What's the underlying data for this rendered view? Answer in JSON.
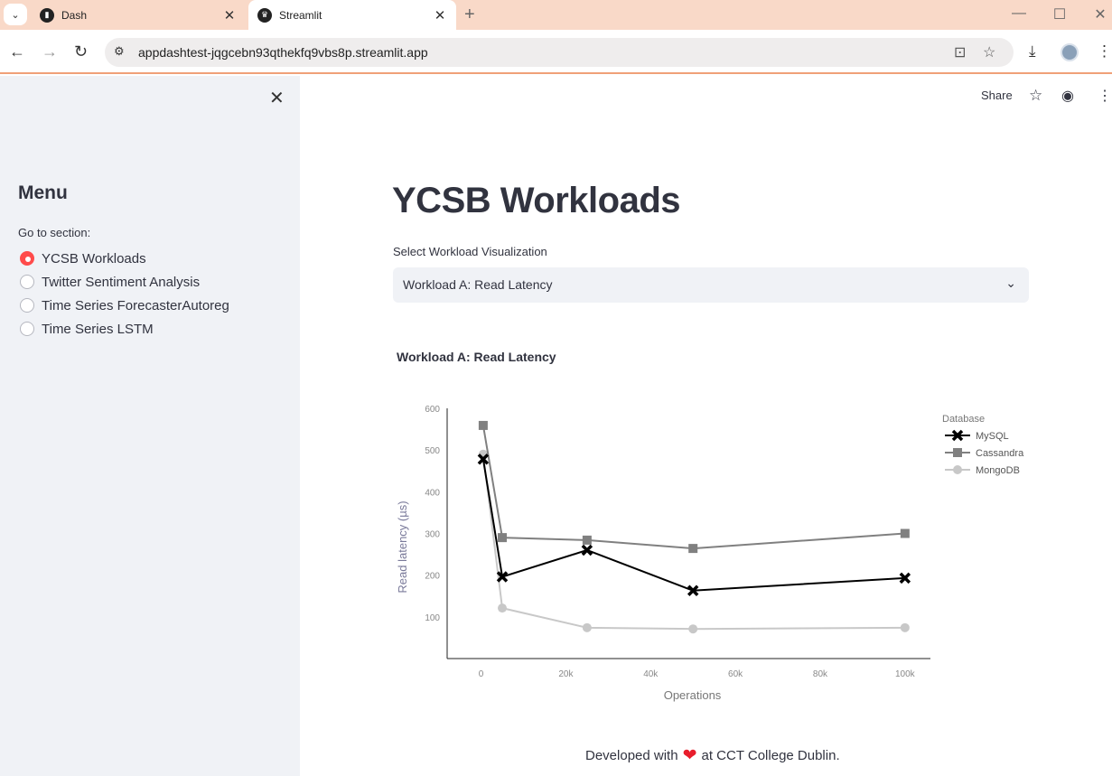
{
  "browser": {
    "tabs": [
      {
        "title": "Dash",
        "active": false
      },
      {
        "title": "Streamlit",
        "active": true
      }
    ],
    "url": "appdashtest-jqgcebn93qthekfq9vbs8p.streamlit.app",
    "accent_color": "#f9d9c8"
  },
  "toolbar": {
    "share_label": "Share"
  },
  "sidebar": {
    "title": "Menu",
    "section_label": "Go to section:",
    "options": [
      {
        "label": "YCSB Workloads",
        "selected": true
      },
      {
        "label": "Twitter Sentiment Analysis",
        "selected": false
      },
      {
        "label": "Time Series ForecasterAutoreg",
        "selected": false
      },
      {
        "label": "Time Series LSTM",
        "selected": false
      }
    ]
  },
  "main": {
    "title": "YCSB Workloads",
    "select_label": "Select Workload Visualization",
    "select_value": "Workload A: Read Latency"
  },
  "chart_data": {
    "type": "line",
    "title": "Workload A: Read Latency",
    "xlabel": "Operations",
    "ylabel": "Read latency (µs)",
    "xlim": [
      -8000,
      106000
    ],
    "ylim": [
      0,
      600
    ],
    "x_ticks": [
      0,
      20000,
      40000,
      60000,
      80000,
      100000
    ],
    "x_tick_labels": [
      "0",
      "20k",
      "40k",
      "60k",
      "80k",
      "100k"
    ],
    "y_ticks": [
      100,
      200,
      300,
      400,
      500,
      600
    ],
    "y_tick_labels": [
      "100",
      "200",
      "300",
      "400",
      "500",
      "600"
    ],
    "legend_title": "Database",
    "legend_position": "top-right",
    "series": [
      {
        "name": "MySQL",
        "color": "#000000",
        "marker": "cross",
        "x": [
          500,
          5000,
          25000,
          50000,
          100000
        ],
        "values": [
          478,
          196,
          260,
          163,
          193
        ]
      },
      {
        "name": "Cassandra",
        "color": "#808080",
        "marker": "square",
        "x": [
          500,
          5000,
          25000,
          50000,
          100000
        ],
        "values": [
          559,
          290,
          284,
          264,
          300
        ]
      },
      {
        "name": "MongoDB",
        "color": "#c8c8c8",
        "marker": "circle",
        "x": [
          500,
          5000,
          25000,
          50000,
          100000
        ],
        "values": [
          490,
          121,
          74,
          71,
          74
        ]
      }
    ]
  },
  "footer": {
    "prefix": "Developed with",
    "suffix": "at CCT College Dublin."
  }
}
